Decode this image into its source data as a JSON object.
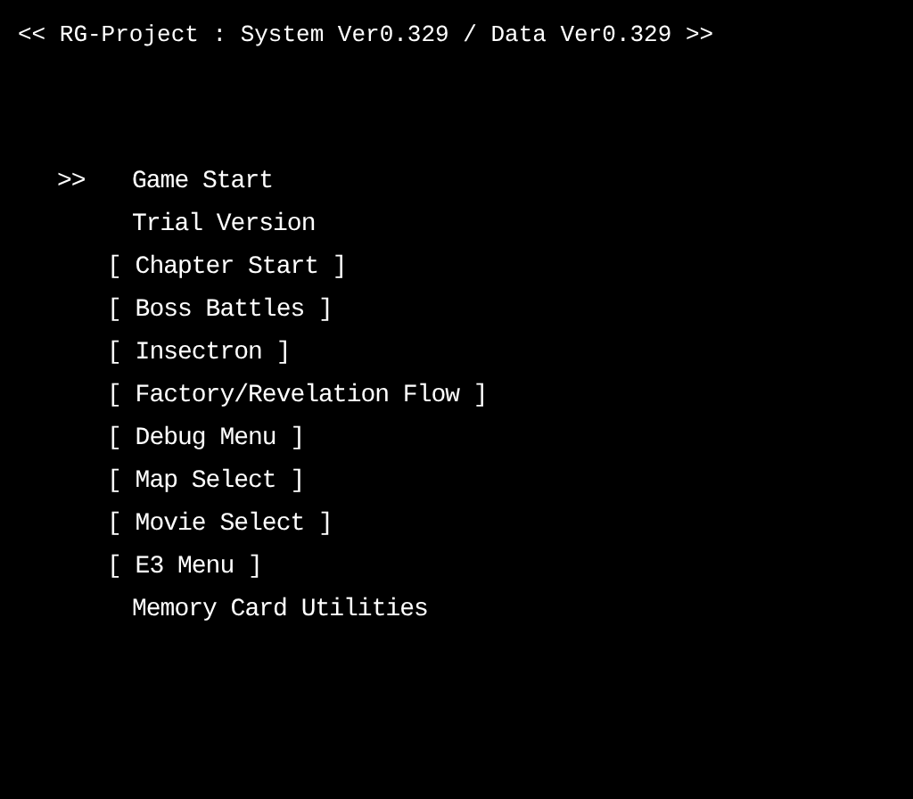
{
  "title": "<< RG-Project : System Ver0.329 / Data Ver0.329 >>",
  "cursor": ">>",
  "menu": [
    {
      "label": "Game Start",
      "kind": "plain",
      "selected": true
    },
    {
      "label": "Trial Version",
      "kind": "plain",
      "selected": false
    },
    {
      "label": "[ Chapter Start ]",
      "kind": "bracketed",
      "selected": false
    },
    {
      "label": "[ Boss Battles ]",
      "kind": "bracketed",
      "selected": false
    },
    {
      "label": "[ Insectron ]",
      "kind": "bracketed",
      "selected": false
    },
    {
      "label": "[ Factory/Revelation Flow ]",
      "kind": "bracketed",
      "selected": false
    },
    {
      "label": "[ Debug Menu ]",
      "kind": "bracketed",
      "selected": false
    },
    {
      "label": "[ Map Select ]",
      "kind": "bracketed",
      "selected": false
    },
    {
      "label": "[ Movie Select ]",
      "kind": "bracketed",
      "selected": false
    },
    {
      "label": "[ E3 Menu ]",
      "kind": "bracketed",
      "selected": false
    },
    {
      "label": "Memory Card Utilities",
      "kind": "plain",
      "selected": false
    }
  ]
}
